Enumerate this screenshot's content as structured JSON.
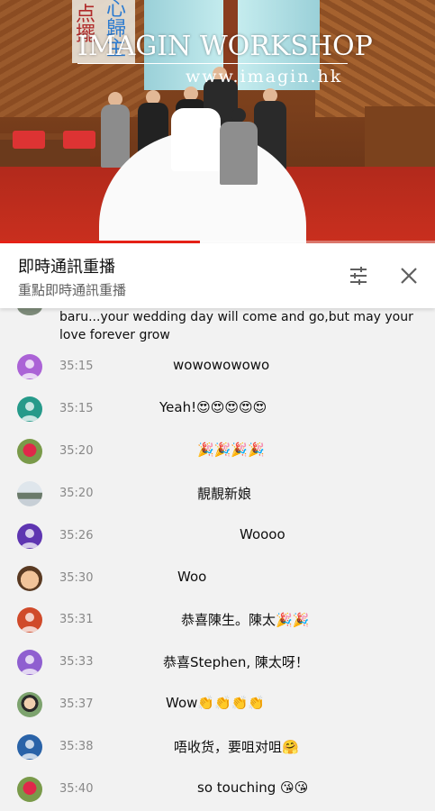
{
  "video": {
    "watermark_title": "IMAGIN WORKSHOP",
    "watermark_url": "www.imagin.hk",
    "banner_chars_left": "点擺",
    "banner_chars_right": "心歸主",
    "progress": 0.46
  },
  "header": {
    "title": "即時通訊重播",
    "subtitle": "重點即時通訊重播",
    "filter_icon": "tune-icon",
    "close_icon": "close-icon"
  },
  "chat": {
    "partial_message": "baru...your wedding day will come and go,but may your love forever grow",
    "messages": [
      {
        "time": "35:15",
        "text": "wowowowowo",
        "avatar": "default",
        "avatar_color": "#ab63d6"
      },
      {
        "time": "35:15",
        "text": "Yeah!😍😍😍😍😍",
        "avatar": "default",
        "avatar_color": "#269a8a"
      },
      {
        "time": "35:20",
        "text": "🎉🎉🎉🎉",
        "avatar": "photo-rose",
        "avatar_color": "#6a8f4a"
      },
      {
        "time": "35:20",
        "text": "靚靚新娘",
        "avatar": "photo-landscape",
        "avatar_color": "#c9d3dc"
      },
      {
        "time": "35:26",
        "text": "Woooo",
        "avatar": "default",
        "avatar_color": "#5e35b1"
      },
      {
        "time": "35:30",
        "text": "Woo",
        "avatar": "photo-child",
        "avatar_color": "#e0a070"
      },
      {
        "time": "35:31",
        "text": "恭喜陳生。陳太🎉🎉",
        "avatar": "default",
        "avatar_color": "#d04a2a"
      },
      {
        "time": "35:33",
        "text": "恭喜Stephen, 陳太呀！",
        "avatar": "default",
        "avatar_color": "#8f5fd0"
      },
      {
        "time": "35:37",
        "text": "Wow👏👏👏👏",
        "avatar": "photo-person",
        "avatar_color": "#5d8b5a"
      },
      {
        "time": "35:38",
        "text": "唔收货，要咀对咀🤗",
        "avatar": "default",
        "avatar_color": "#2a63a8"
      },
      {
        "time": "35:40",
        "text": "so touching 😘😘",
        "avatar": "photo-rose",
        "avatar_color": "#6a8f4a"
      }
    ]
  }
}
